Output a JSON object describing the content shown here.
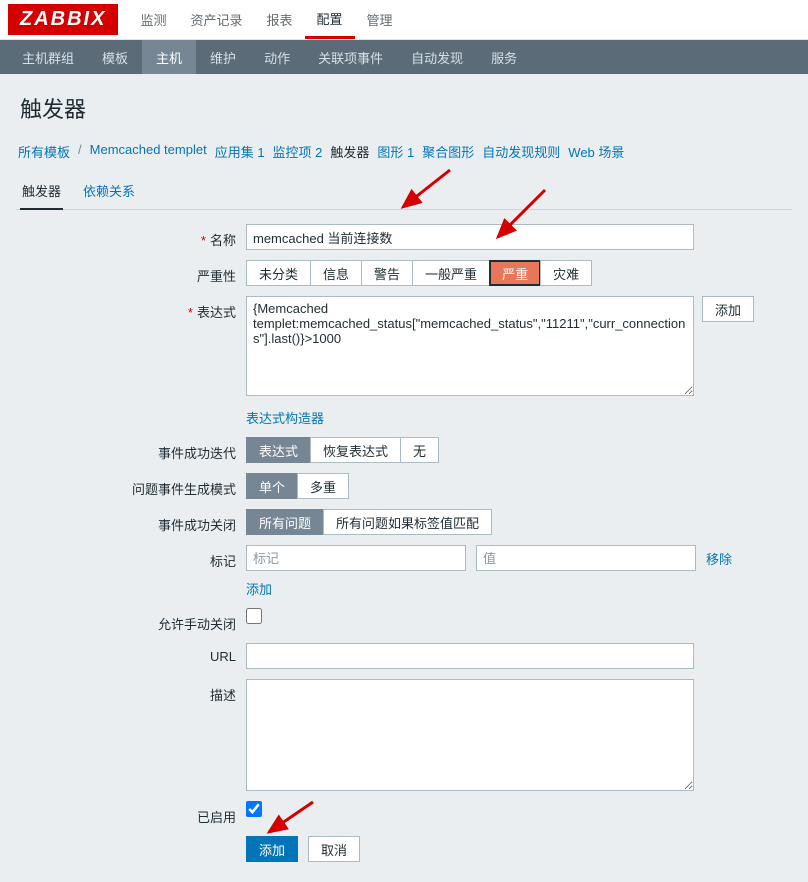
{
  "logo": "ZABBIX",
  "topnav": {
    "items": [
      "监测",
      "资产记录",
      "报表",
      "配置",
      "管理"
    ],
    "active": 3
  },
  "subnav": {
    "items": [
      "主机群组",
      "模板",
      "主机",
      "维护",
      "动作",
      "关联项事件",
      "自动发现",
      "服务"
    ],
    "active": 2
  },
  "page_title": "触发器",
  "breadcrumb": {
    "all_templates": "所有模板",
    "template": "Memcached templet",
    "appset": "应用集 1",
    "items": "监控项 2",
    "triggers_cur": "触发器",
    "graphs": "图形 1",
    "agg": "聚合图形",
    "discovery": "自动发现规则",
    "web": "Web 场景"
  },
  "tabs": {
    "trigger": "触发器",
    "deps": "依赖关系"
  },
  "labels": {
    "name": "名称",
    "severity": "严重性",
    "expression": "表达式",
    "expr_builder": "表达式构造器",
    "ok_event_gen": "事件成功迭代",
    "problem_mode": "问题事件生成模式",
    "ok_close": "事件成功关闭",
    "tags": "标记",
    "manual_close": "允许手动关闭",
    "url": "URL",
    "desc": "描述",
    "enabled": "已启用"
  },
  "values": {
    "name": "memcached 当前连接数",
    "expression": "{Memcached templet:memcached_status[\"memcached_status\",\"11211\",\"curr_connections\"].last()}>1000",
    "url": "",
    "desc": "",
    "tag_name": "",
    "tag_value": "",
    "enabled": true
  },
  "placeholders": {
    "tag_name": "标记",
    "tag_value": "值"
  },
  "severity": [
    "未分类",
    "信息",
    "警告",
    "一般严重",
    "严重",
    "灾难"
  ],
  "severity_active": 4,
  "ok_event_gen": [
    "表达式",
    "恢复表达式",
    "无"
  ],
  "ok_event_gen_active": 0,
  "problem_mode": [
    "单个",
    "多重"
  ],
  "problem_mode_active": 0,
  "ok_close": [
    "所有问题",
    "所有问题如果标签值匹配"
  ],
  "ok_close_active": 0,
  "buttons": {
    "add": "添加",
    "tag_remove": "移除",
    "tag_add": "添加",
    "submit": "添加",
    "cancel": "取消"
  }
}
